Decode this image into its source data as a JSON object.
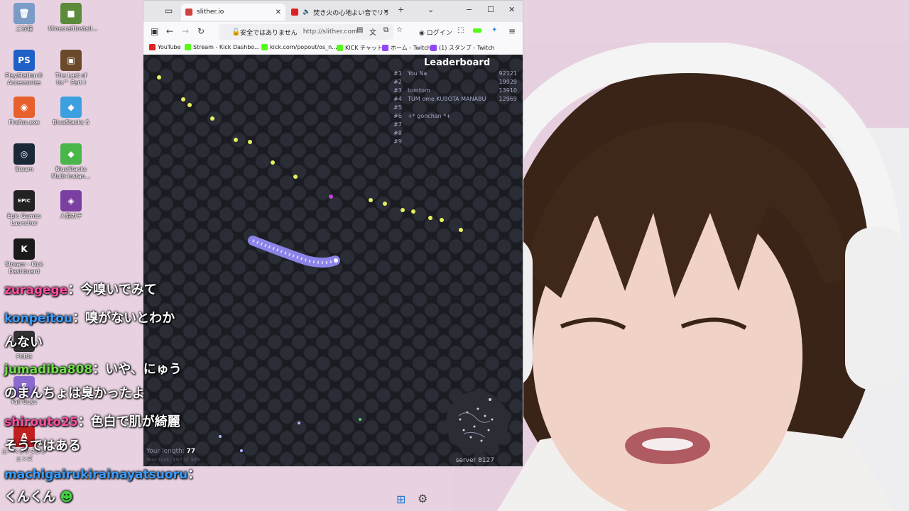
{
  "desktop_icons": [
    {
      "label": "ごみ箱",
      "color": "#7a9cc6",
      "glyph": "🗑"
    },
    {
      "label": "MinecraftInstall...",
      "color": "#5b8a3a",
      "glyph": "■"
    },
    {
      "label": "PlayStation® Accessories",
      "color": "#1f5fc8",
      "glyph": "PS"
    },
    {
      "label": "The Last of Us™ Part I",
      "color": "#6a4a2a",
      "glyph": "▣"
    },
    {
      "label": "Firefox.exe",
      "color": "#e8602c",
      "glyph": "◉"
    },
    {
      "label": "BlueStacks 5",
      "color": "#3ca0e0",
      "glyph": "◆"
    },
    {
      "label": "Steam",
      "color": "#1b2838",
      "glyph": "◎"
    },
    {
      "label": "BlueStacks Multi-Instan...",
      "color": "#49b649",
      "glyph": "◆"
    },
    {
      "label": "Epic Games Launcher",
      "color": "#222222",
      "glyph": "EPIC"
    },
    {
      "label": "人狼ガチ",
      "color": "#7a3fa0",
      "glyph": "◈"
    },
    {
      "label": "Stream - Kick Dashboard",
      "color": "#1a1a1a",
      "glyph": "K"
    },
    {
      "label": "PUBG",
      "color": "#333333",
      "glyph": "P"
    },
    {
      "label": "Fall Guys",
      "color": "#8a6ad0",
      "glyph": "F"
    },
    {
      "label": "エーペックスレジェンズ",
      "color": "#c02020",
      "glyph": "A"
    }
  ],
  "browser": {
    "tabs": [
      {
        "title": "slither.io",
        "active": true,
        "fav_color": "#d04040"
      },
      {
        "title": "焚き火の心地よい音でリラック",
        "active": false,
        "fav_color": "#e02020"
      }
    ],
    "nav": {
      "security_text": "安全ではありません",
      "url": "http://slither.com",
      "login_label": "ログイン"
    },
    "bookmarks": [
      {
        "label": "YouTube",
        "color": "#e02020"
      },
      {
        "label": "Stream - Kick Dashbo...",
        "color": "#53fc18"
      },
      {
        "label": "kick.com/popout/os_n...",
        "color": "#53fc18"
      },
      {
        "label": "KICK チャット",
        "color": "#53fc18"
      },
      {
        "label": "ホーム - Twitch",
        "color": "#9146ff"
      },
      {
        "label": "(1) スタンプ - Twitch",
        "color": "#9146ff"
      }
    ]
  },
  "game": {
    "leaderboard_title": "Leaderboard",
    "leaderboard": [
      {
        "rank": "#1",
        "name": "You Na",
        "score": "92121"
      },
      {
        "rank": "#2",
        "name": "",
        "score": "19929"
      },
      {
        "rank": "#3",
        "name": "tomtom",
        "score": "13910"
      },
      {
        "rank": "#4",
        "name": "TUM ome KUBOTA MANABU",
        "score": "12969"
      },
      {
        "rank": "#5",
        "name": "",
        "score": ""
      },
      {
        "rank": "#6",
        "name": "+* gonchan *+",
        "score": ""
      },
      {
        "rank": "#7",
        "name": "",
        "score": ""
      },
      {
        "rank": "#8",
        "name": "",
        "score": ""
      },
      {
        "rank": "#9",
        "name": "",
        "score": ""
      }
    ],
    "your_length_label": "Your length:",
    "your_length": "77",
    "your_rank_text": "Your rank: 167 of 305",
    "server": "server 8127"
  },
  "chat": [
    {
      "user": "zuragege",
      "user_color": "#ff4fa0",
      "text": "：今嗅いでみて"
    },
    {
      "user": "konpeitou",
      "user_color": "#3a9cff",
      "text": "：嗅がないとわか"
    },
    {
      "user": "",
      "user_color": "#ffffff",
      "text": "んない"
    },
    {
      "user": "jumadiba808",
      "user_color": "#6fe04a",
      "text": "：いや、にゅう"
    },
    {
      "user": "",
      "user_color": "#ffffff",
      "text": "のまんちょは臭かったよ"
    },
    {
      "user": "shirouto25",
      "user_color": "#ff4fa0",
      "text": "：色白で肌が綺麗"
    },
    {
      "user": "",
      "user_color": "#ffffff",
      "text": "そうではある"
    },
    {
      "user": "machigairukirainayatsuoru",
      "user_color": "#3a9cff",
      "text": "："
    },
    {
      "user": "",
      "user_color": "#ffffff",
      "text": "くんくん"
    }
  ]
}
